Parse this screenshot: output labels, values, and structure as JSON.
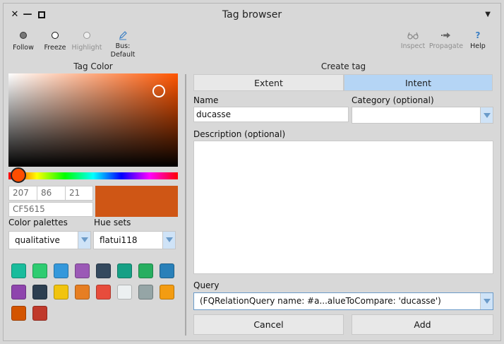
{
  "window": {
    "title": "Tag browser",
    "controls": {
      "close": "✕",
      "minimize": "—"
    }
  },
  "toolbar": {
    "left": [
      {
        "label": "Follow",
        "icon": "follow-dot-icon"
      },
      {
        "label": "Freeze",
        "icon": "freeze-dot-icon"
      },
      {
        "label": "Highlight",
        "icon": "highlight-dot-icon"
      },
      {
        "label": "Bus: Default",
        "icon": "pencil-icon"
      }
    ],
    "right": [
      {
        "label": "Inspect",
        "icon": "glasses-icon"
      },
      {
        "label": "Propagate",
        "icon": "arrow-icon"
      },
      {
        "label": "Help",
        "icon": "question-icon",
        "glyph": "?"
      }
    ]
  },
  "tag_color": {
    "header": "Tag Color",
    "r": "207",
    "g": "86",
    "b": "21",
    "hex": "CF5615",
    "preview_color": "#cf5615",
    "palettes_label": "Color palettes",
    "palette_value": "qualitative",
    "hue_sets_label": "Hue sets",
    "hue_set_value": "flatui118",
    "swatches": [
      "#1abc9c",
      "#2ecc71",
      "#3498db",
      "#9b59b6",
      "#34495e",
      "#16a085",
      "#27ae60",
      "#2980b9",
      "#8e44ad",
      "#2c3e50",
      "#f1c40f",
      "#e67e22",
      "#e74c3c",
      "#ecf0f1",
      "#95a5a6",
      "#f39c12",
      "#d35400",
      "#c0392b"
    ]
  },
  "create_tag": {
    "header": "Create tag",
    "tabs": [
      "Extent",
      "Intent"
    ],
    "selected_tab": "Intent",
    "name_label": "Name",
    "name_value": "ducasse",
    "category_label": "Category (optional)",
    "category_value": "",
    "description_label": "Description (optional)",
    "description_value": "",
    "query_label": "Query",
    "query_value": "(FQRelationQuery name: #a...alueToCompare: 'ducasse')",
    "cancel_label": "Cancel",
    "add_label": "Add"
  },
  "colors": {
    "accent": "#b5d5f5",
    "dropdown_button": "#cfe3f7"
  }
}
